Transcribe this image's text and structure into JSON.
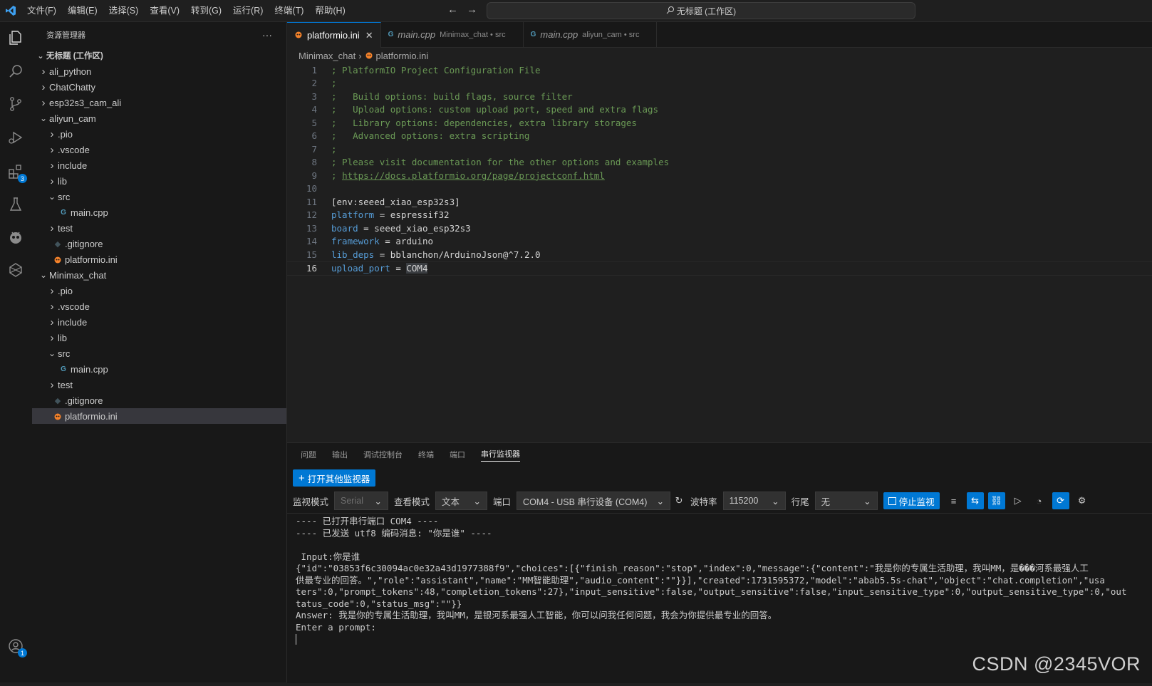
{
  "titlebar": {
    "menu": [
      "文件(F)",
      "编辑(E)",
      "选择(S)",
      "查看(V)",
      "转到(G)",
      "运行(R)",
      "终端(T)",
      "帮助(H)"
    ],
    "search": "无标题 (工作区)"
  },
  "activity": {
    "icons": [
      "explorer-icon",
      "search-icon",
      "source-control-icon",
      "run-debug-icon",
      "extensions-icon",
      "testing-icon",
      "platformio-icon",
      "remote-icon",
      "accounts-icon"
    ],
    "extensions_badge": "3",
    "accounts_badge": "1"
  },
  "sidebar": {
    "title": "资源管理器",
    "more": "···",
    "workspace": "无标题 (工作区)",
    "items": [
      {
        "label": "ali_python",
        "depth": 1,
        "type": "folder",
        "open": false
      },
      {
        "label": "ChatChatty",
        "depth": 1,
        "type": "folder",
        "open": false
      },
      {
        "label": "esp32s3_cam_ali",
        "depth": 1,
        "type": "folder",
        "open": false
      },
      {
        "label": "aliyun_cam",
        "depth": 1,
        "type": "folder",
        "open": true
      },
      {
        "label": ".pio",
        "depth": 2,
        "type": "folder",
        "open": false
      },
      {
        "label": ".vscode",
        "depth": 2,
        "type": "folder",
        "open": false
      },
      {
        "label": "include",
        "depth": 2,
        "type": "folder",
        "open": false
      },
      {
        "label": "lib",
        "depth": 2,
        "type": "folder",
        "open": false
      },
      {
        "label": "src",
        "depth": 2,
        "type": "folder",
        "open": true
      },
      {
        "label": "main.cpp",
        "depth": 3,
        "type": "cpp"
      },
      {
        "label": "test",
        "depth": 2,
        "type": "folder",
        "open": false
      },
      {
        "label": ".gitignore",
        "depth": 2,
        "type": "git"
      },
      {
        "label": "platformio.ini",
        "depth": 2,
        "type": "pio"
      },
      {
        "label": "Minimax_chat",
        "depth": 1,
        "type": "folder",
        "open": true
      },
      {
        "label": ".pio",
        "depth": 2,
        "type": "folder",
        "open": false
      },
      {
        "label": ".vscode",
        "depth": 2,
        "type": "folder",
        "open": false
      },
      {
        "label": "include",
        "depth": 2,
        "type": "folder",
        "open": false
      },
      {
        "label": "lib",
        "depth": 2,
        "type": "folder",
        "open": false
      },
      {
        "label": "src",
        "depth": 2,
        "type": "folder",
        "open": true
      },
      {
        "label": "main.cpp",
        "depth": 3,
        "type": "cpp"
      },
      {
        "label": "test",
        "depth": 2,
        "type": "folder",
        "open": false
      },
      {
        "label": ".gitignore",
        "depth": 2,
        "type": "git"
      },
      {
        "label": "platformio.ini",
        "depth": 2,
        "type": "pio",
        "selected": true
      }
    ]
  },
  "editor": {
    "tabs": [
      {
        "label": "platformio.ini",
        "desc": "",
        "active": true,
        "icon": "pio"
      },
      {
        "label": "main.cpp",
        "desc": "Minimax_chat • src",
        "active": false,
        "icon": "cpp"
      },
      {
        "label": "main.cpp",
        "desc": "aliyun_cam • src",
        "active": false,
        "icon": "cpp"
      }
    ],
    "close_glyph": "✕",
    "breadcrumb": [
      "Minimax_chat",
      "platformio.ini"
    ],
    "lines": [
      {
        "n": "1",
        "t": "; PlatformIO Project Configuration File",
        "k": "comment"
      },
      {
        "n": "2",
        "t": ";",
        "k": "comment"
      },
      {
        "n": "3",
        "t": ";   Build options: build flags, source filter",
        "k": "comment"
      },
      {
        "n": "4",
        "t": ";   Upload options: custom upload port, speed and extra flags",
        "k": "comment"
      },
      {
        "n": "5",
        "t": ";   Library options: dependencies, extra library storages",
        "k": "comment"
      },
      {
        "n": "6",
        "t": ";   Advanced options: extra scripting",
        "k": "comment"
      },
      {
        "n": "7",
        "t": ";",
        "k": "comment"
      },
      {
        "n": "8",
        "t": "; Please visit documentation for the other options and examples",
        "k": "comment"
      },
      {
        "n": "9",
        "t": "; ",
        "link": "https://docs.platformio.org/page/projectconf.html",
        "k": "link"
      },
      {
        "n": "10",
        "t": "",
        "k": "blank"
      },
      {
        "n": "11",
        "t": "[env:seeed_xiao_esp32s3]",
        "k": "section"
      },
      {
        "n": "12",
        "key": "platform",
        "val": "espressif32",
        "k": "kv"
      },
      {
        "n": "13",
        "key": "board",
        "val": "seeed_xiao_esp32s3",
        "k": "kv"
      },
      {
        "n": "14",
        "key": "framework",
        "val": "arduino",
        "k": "kv"
      },
      {
        "n": "15",
        "key": "lib_deps",
        "val": "bblanchon/ArduinoJson@^7.2.0",
        "k": "kv"
      },
      {
        "n": "16",
        "key": "upload_port",
        "val": "COM4",
        "k": "kv",
        "current": true
      }
    ]
  },
  "panel": {
    "tabs": [
      "问题",
      "输出",
      "调试控制台",
      "终端",
      "端口",
      "串行监视器"
    ],
    "active_tab": 5,
    "open_button": "打开其他监视器",
    "controls": {
      "mode_label": "监视模式",
      "mode_value": "Serial",
      "view_label": "查看模式",
      "view_value": "文本",
      "port_label": "端口",
      "port_value": "COM4 - USB 串行设备 (COM4)",
      "baud_label": "波特率",
      "baud_value": "115200",
      "eol_label": "行尾",
      "eol_value": "无",
      "stop_button": "停止监视"
    },
    "output": [
      "---- 已打开串行端口 COM4 ----",
      "---- 已发送 utf8 编码消息: \"你是谁\" ----",
      "",
      " Input:你是谁",
      "{\"id\":\"03853f6c30094ac0e32a43d1977388f9\",\"choices\":[{\"finish_reason\":\"stop\",\"index\":0,\"message\":{\"content\":\"我是你的专属生活助理，我叫MM，是���河系最强人工",
      "供最专业的回答。\",\"role\":\"assistant\",\"name\":\"MM智能助理\",\"audio_content\":\"\"}}],\"created\":1731595372,\"model\":\"abab5.5s-chat\",\"object\":\"chat.completion\",\"usa",
      "ters\":0,\"prompt_tokens\":48,\"completion_tokens\":27},\"input_sensitive\":false,\"output_sensitive\":false,\"input_sensitive_type\":0,\"output_sensitive_type\":0,\"out",
      "tatus_code\":0,\"status_msg\":\"\"}}",
      "Answer: 我是你的专属生活助理，我叫MM，是银河系最强人工智能，你可以问我任何问题，我会为你提供最专业的回答。",
      "Enter a prompt:"
    ]
  },
  "watermark": "CSDN @2345VOR"
}
